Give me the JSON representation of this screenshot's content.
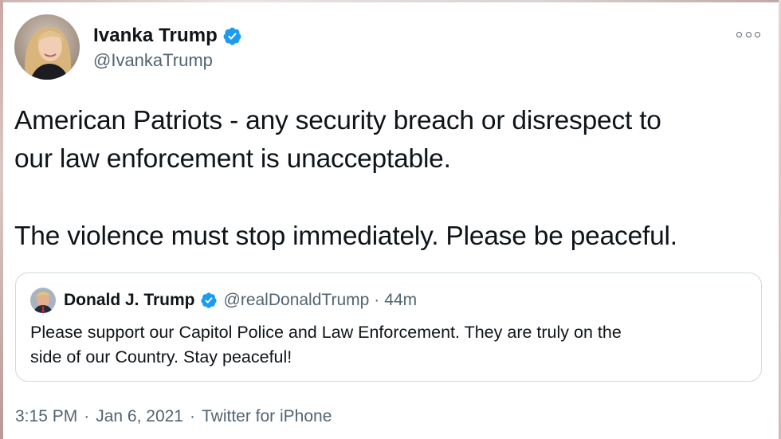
{
  "author": {
    "display_name": "Ivanka Trump",
    "handle": "@IvankaTrump",
    "verified": true
  },
  "tweet": {
    "line1": "American Patriots - any security breach or disrespect to",
    "line2": "our law enforcement is unacceptable.",
    "line3": "The violence must stop immediately. Please be peaceful."
  },
  "quoted_tweet": {
    "display_name": "Donald J. Trump",
    "handle": "@realDonaldTrump",
    "separator": "·",
    "time": "44m",
    "line1": "Please support our Capitol Police and Law Enforcement. They are truly on the",
    "line2": "side of our Country. Stay peaceful!"
  },
  "footer": {
    "time": "3:15 PM",
    "separator": "·",
    "date": "Jan 6, 2021",
    "source": "Twitter for iPhone"
  },
  "icons": {
    "verified": "verified-badge-icon",
    "more": "more-options-icon"
  },
  "colors": {
    "text": "#0f1419",
    "secondary": "#536471",
    "verified": "#1d9bf0",
    "border": "#cfd9de"
  }
}
